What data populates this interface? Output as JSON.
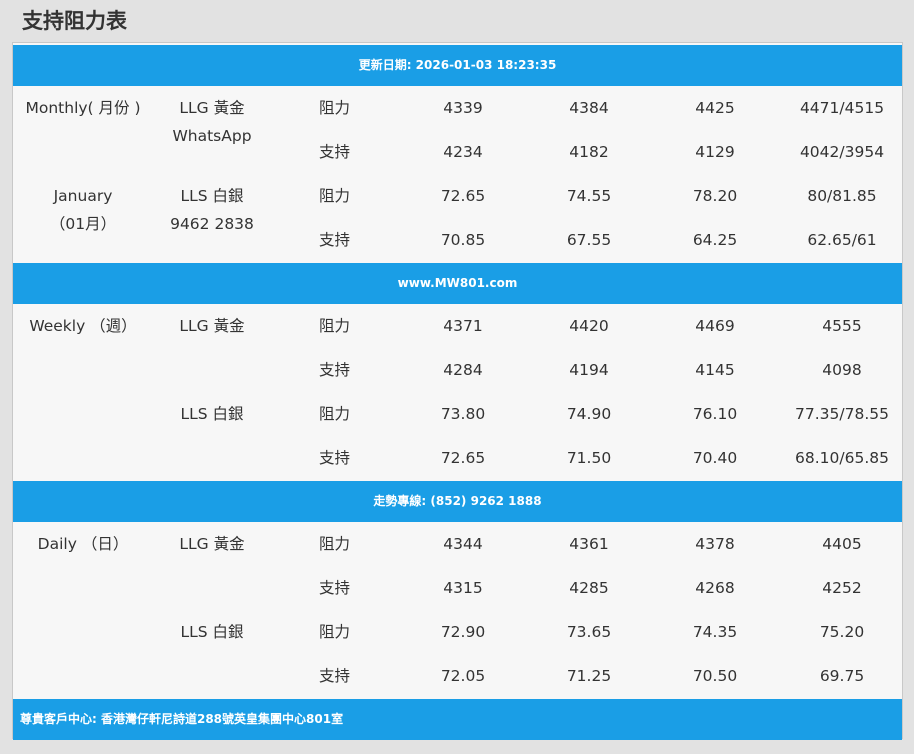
{
  "page_title": "支持阻力表",
  "bars": {
    "updated": "更新日期: 2026-01-03 18:23:35",
    "website": "www.MW801.com",
    "hotline": "走勢專線: (852) 9262 1888",
    "address": "尊貴客戶中心: 香港灣仔軒尼詩道288號英皇集團中心801室"
  },
  "labels": {
    "resistance": "阻力",
    "support": "支持"
  },
  "monthly": {
    "period": "Monthly( 月份 )",
    "month_name": "January",
    "month_num": "（01月）",
    "gold_label": "LLG 黃金",
    "whatsapp": "WhatsApp",
    "silver_label": "LLS 白銀",
    "phone": "9462 2838",
    "gold_res": [
      "4339",
      "4384",
      "4425",
      "4471/4515"
    ],
    "gold_sup": [
      "4234",
      "4182",
      "4129",
      "4042/3954"
    ],
    "silver_res": [
      "72.65",
      "74.55",
      "78.20",
      "80/81.85"
    ],
    "silver_sup": [
      "70.85",
      "67.55",
      "64.25",
      "62.65/61"
    ]
  },
  "weekly": {
    "period": "Weekly （週）",
    "gold_label": "LLG 黃金",
    "silver_label": "LLS 白銀",
    "gold_res": [
      "4371",
      "4420",
      "4469",
      "4555"
    ],
    "gold_sup": [
      "4284",
      "4194",
      "4145",
      "4098"
    ],
    "silver_res": [
      "73.80",
      "74.90",
      "76.10",
      "77.35/78.55"
    ],
    "silver_sup": [
      "72.65",
      "71.50",
      "70.40",
      "68.10/65.85"
    ]
  },
  "daily": {
    "period": "Daily （日）",
    "gold_label": "LLG 黃金",
    "silver_label": "LLS 白銀",
    "gold_res": [
      "4344",
      "4361",
      "4378",
      "4405"
    ],
    "gold_sup": [
      "4315",
      "4285",
      "4268",
      "4252"
    ],
    "silver_res": [
      "72.90",
      "73.65",
      "74.35",
      "75.20"
    ],
    "silver_sup": [
      "72.05",
      "71.25",
      "70.50",
      "69.75"
    ]
  }
}
